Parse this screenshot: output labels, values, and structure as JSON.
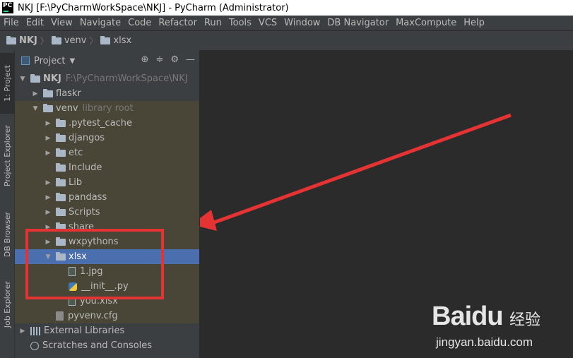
{
  "window": {
    "title": "NKJ [F:\\PyCharmWorkSpace\\NKJ] - PyCharm (Administrator)",
    "logo": "PC"
  },
  "menu": [
    "File",
    "Edit",
    "View",
    "Navigate",
    "Code",
    "Refactor",
    "Run",
    "Tools",
    "VCS",
    "Window",
    "DB Navigator",
    "MaxCompute",
    "Help"
  ],
  "breadcrumb": [
    "NKJ",
    "venv",
    "xlsx"
  ],
  "side_tabs": [
    "1: Project",
    "Project Explorer",
    "DB Browser",
    "Job Explorer"
  ],
  "project_panel": {
    "title": "Project"
  },
  "tree": [
    {
      "label": "NKJ",
      "hint": "F:\\PyCharmWorkSpace\\NKJ",
      "depth": 0,
      "arrow": "down",
      "icon": "folder"
    },
    {
      "label": "flaskr",
      "hint": "",
      "depth": 1,
      "arrow": "right",
      "icon": "folder"
    },
    {
      "label": "venv",
      "hint": "library root",
      "depth": 1,
      "arrow": "down",
      "icon": "folder"
    },
    {
      "label": ".pytest_cache",
      "hint": "",
      "depth": 2,
      "arrow": "right",
      "icon": "folder"
    },
    {
      "label": "djangos",
      "hint": "",
      "depth": 2,
      "arrow": "right",
      "icon": "folder"
    },
    {
      "label": "etc",
      "hint": "",
      "depth": 2,
      "arrow": "right",
      "icon": "folder"
    },
    {
      "label": "Include",
      "hint": "",
      "depth": 2,
      "arrow": "none",
      "icon": "folder"
    },
    {
      "label": "Lib",
      "hint": "",
      "depth": 2,
      "arrow": "right",
      "icon": "folder"
    },
    {
      "label": "pandass",
      "hint": "",
      "depth": 2,
      "arrow": "right",
      "icon": "folder"
    },
    {
      "label": "Scripts",
      "hint": "",
      "depth": 2,
      "arrow": "right",
      "icon": "folder"
    },
    {
      "label": "share",
      "hint": "",
      "depth": 2,
      "arrow": "right",
      "icon": "folder"
    },
    {
      "label": "wxpythons",
      "hint": "",
      "depth": 2,
      "arrow": "right",
      "icon": "folder"
    },
    {
      "label": "xlsx",
      "hint": "",
      "depth": 2,
      "arrow": "down",
      "icon": "folder",
      "selected": true
    },
    {
      "label": "1.jpg",
      "hint": "",
      "depth": 3,
      "arrow": "none",
      "icon": "file"
    },
    {
      "label": "__init__.py",
      "hint": "",
      "depth": 3,
      "arrow": "none",
      "icon": "py"
    },
    {
      "label": "you.xlsx",
      "hint": "",
      "depth": 3,
      "arrow": "none",
      "icon": "file"
    },
    {
      "label": "pyvenv.cfg",
      "hint": "",
      "depth": 2,
      "arrow": "none",
      "icon": "cfg"
    },
    {
      "label": "External Libraries",
      "hint": "",
      "depth": 0,
      "arrow": "right",
      "icon": "lib"
    },
    {
      "label": "Scratches and Consoles",
      "hint": "",
      "depth": 0,
      "arrow": "none",
      "icon": "scratch"
    }
  ],
  "watermark": {
    "logo": "Baidu",
    "cn": "经验",
    "url": "jingyan.baidu.com"
  },
  "colors": {
    "selection": "#4b6eaf",
    "highlight": "#e53333",
    "arrow": "#e53333"
  }
}
